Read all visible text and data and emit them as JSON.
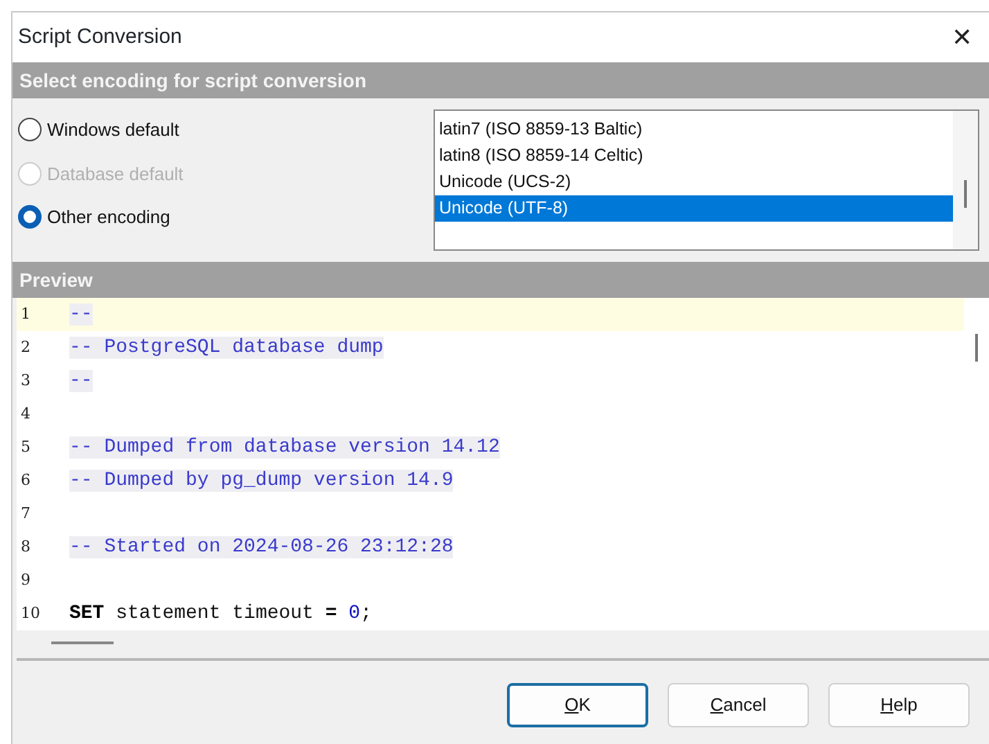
{
  "window": {
    "title": "Script Conversion",
    "close": "✕"
  },
  "encoding_section": {
    "title": "Select encoding for script conversion",
    "options": [
      {
        "label": "Windows default",
        "selected": false,
        "disabled": false
      },
      {
        "label": "Database default",
        "selected": false,
        "disabled": true
      },
      {
        "label": "Other encoding",
        "selected": true,
        "disabled": false
      }
    ],
    "encodings": [
      {
        "label": "latin7 (ISO 8859-13 Baltic)",
        "selected": false
      },
      {
        "label": "latin8 (ISO 8859-14 Celtic)",
        "selected": false
      },
      {
        "label": "Unicode (UCS-2)",
        "selected": false
      },
      {
        "label": "Unicode (UTF-8)",
        "selected": true
      }
    ]
  },
  "preview": {
    "title": "Preview",
    "lines": [
      {
        "number": "1",
        "current": true,
        "segments": [
          {
            "kind": "comment",
            "text": "--"
          }
        ]
      },
      {
        "number": "2",
        "current": false,
        "segments": [
          {
            "kind": "comment",
            "text": "-- PostgreSQL database dump"
          }
        ]
      },
      {
        "number": "3",
        "current": false,
        "segments": [
          {
            "kind": "comment",
            "text": "--"
          }
        ]
      },
      {
        "number": "4",
        "current": false
      },
      {
        "number": "5",
        "current": false,
        "segments": [
          {
            "kind": "comment",
            "text": "-- Dumped from database version 14.12"
          }
        ]
      },
      {
        "number": "6",
        "current": false,
        "segments": [
          {
            "kind": "comment",
            "text": "-- Dumped by pg_dump version 14.9"
          }
        ]
      },
      {
        "number": "7",
        "current": false
      },
      {
        "number": "8",
        "current": false,
        "segments": [
          {
            "kind": "comment",
            "text": "-- Started on 2024-08-26 23:12:28"
          }
        ]
      },
      {
        "number": "9",
        "current": false
      },
      {
        "number": "10",
        "current": false,
        "segments": [
          {
            "kind": "keyword",
            "text": "SET"
          },
          {
            "kind": "plain",
            "text": "statement timeout"
          },
          {
            "kind": "operator",
            "text": "="
          },
          {
            "kind": "number",
            "text": "0"
          },
          {
            "kind": "plain",
            "text": ";"
          }
        ]
      }
    ]
  },
  "buttons": [
    {
      "label": "OK",
      "default": true
    },
    {
      "label": "Cancel",
      "default": false
    },
    {
      "label": "Help",
      "default": false
    }
  ]
}
